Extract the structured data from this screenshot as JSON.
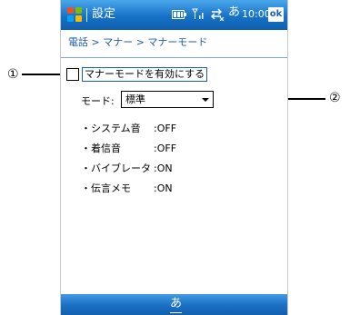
{
  "titlebar": {
    "title": "設定",
    "ime_indicator": "あ",
    "time": "10:00",
    "ok_label": "ok"
  },
  "breadcrumb": "電話 > マナー > マナーモード",
  "manner_checkbox": {
    "label": "マナーモードを有効にする",
    "checked": false
  },
  "mode": {
    "label": "モード:",
    "value": "標準"
  },
  "settings": [
    {
      "name": "・システム音",
      "value": ":OFF"
    },
    {
      "name": "・着信音",
      "value": ":OFF"
    },
    {
      "name": "・バイブレータ",
      "value": ":ON"
    },
    {
      "name": "・伝言メモ",
      "value": ":ON"
    }
  ],
  "bottombar": {
    "ime_label": "あ"
  },
  "callouts": [
    {
      "label": "①"
    },
    {
      "label": "②"
    }
  ]
}
